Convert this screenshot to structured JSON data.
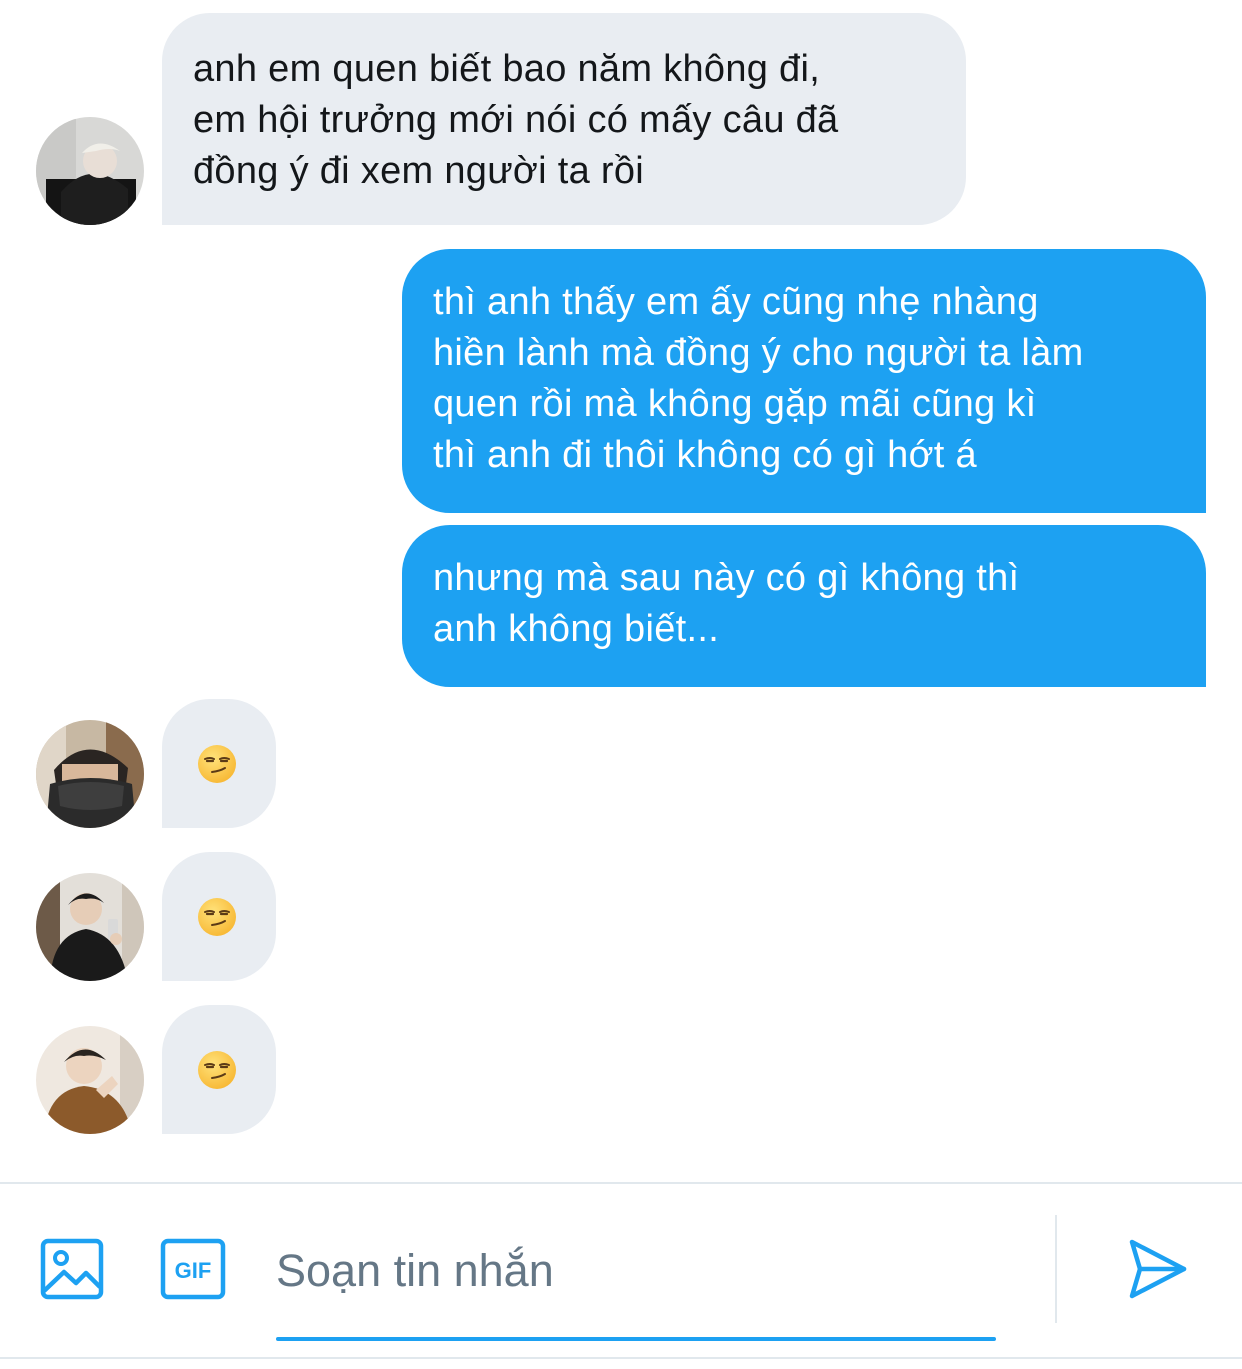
{
  "messages": [
    {
      "id": "msg-1",
      "direction": "incoming",
      "lines": [
        "anh em quen biết bao năm không đi,",
        "em hội trưởng mới nói có mấy câu đã",
        "đồng ý đi xem người ta rồi"
      ]
    },
    {
      "id": "msg-2",
      "direction": "outgoing",
      "lines": [
        "thì anh thấy em ấy cũng nhẹ nhàng",
        "hiền lành mà đồng ý cho người ta làm",
        "quen rồi mà không gặp mãi cũng kì",
        "thì anh đi thôi không có gì hớt á"
      ]
    },
    {
      "id": "msg-3",
      "direction": "outgoing",
      "lines": [
        "nhưng mà sau này có gì không thì",
        "anh không biết..."
      ]
    },
    {
      "id": "msg-4",
      "direction": "incoming",
      "emoji": "smirking-face"
    },
    {
      "id": "msg-5",
      "direction": "incoming",
      "emoji": "smirking-face"
    },
    {
      "id": "msg-6",
      "direction": "incoming",
      "emoji": "smirking-face"
    }
  ],
  "composer": {
    "placeholder": "Soạn tin nhắn",
    "value": "",
    "image_icon": "image-icon",
    "gif_icon": "gif-icon",
    "gif_label": "GIF",
    "send_icon": "send-icon"
  },
  "colors": {
    "accent": "#1da1f2",
    "incoming_bubble": "#e9edf2",
    "outgoing_bubble": "#1da1f2",
    "outgoing_text": "#ffffff",
    "incoming_text": "#14171a",
    "placeholder": "#657786",
    "divider": "#e1e8ed"
  }
}
